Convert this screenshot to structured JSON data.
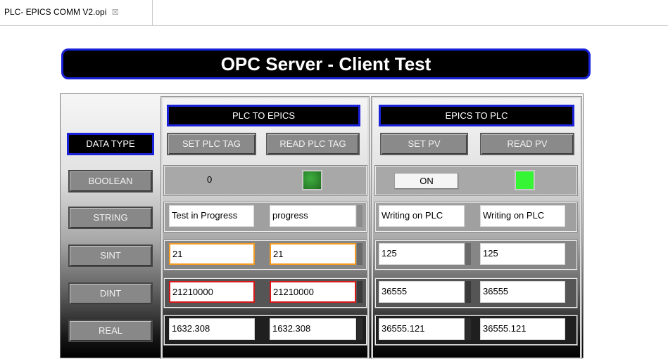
{
  "tab": {
    "title": "PLC- EPICS COMM V2.opi",
    "close_glyph": "☒"
  },
  "title": "OPC Server - Client Test",
  "headers": {
    "plc_to_epics": "PLC TO EPICS",
    "epics_to_plc": "EPICS TO PLC",
    "data_type": "DATA TYPE"
  },
  "buttons": {
    "set_plc_tag": "SET PLC TAG",
    "read_plc_tag": "READ PLC TAG",
    "set_pv": "SET PV",
    "read_pv": "READ PV"
  },
  "rows": {
    "boolean": {
      "label": "BOOLEAN",
      "plc_value": "0",
      "on_label": "ON"
    },
    "string": {
      "label": "STRING",
      "set_plc": "Test in Progress",
      "read_plc": "progress",
      "set_pv": "Writing on PLC",
      "read_pv": "Writing on PLC"
    },
    "sint": {
      "label": "SINT",
      "set_plc": "21",
      "read_plc": "21",
      "set_pv": "125",
      "read_pv": "125"
    },
    "dint": {
      "label": "DINT",
      "set_plc": "21210000",
      "read_plc": "21210000",
      "set_pv": "36555",
      "read_pv": "36555"
    },
    "real": {
      "label": "REAL",
      "set_plc": "1632.308",
      "read_plc": "1632.308",
      "set_pv": "36555.121",
      "read_pv": "36555.121"
    }
  },
  "colors": {
    "accent_blue": "#1a22d9",
    "led_on": "#35f535",
    "warn_orange": "#f39a22",
    "alarm_red": "#d81818"
  }
}
